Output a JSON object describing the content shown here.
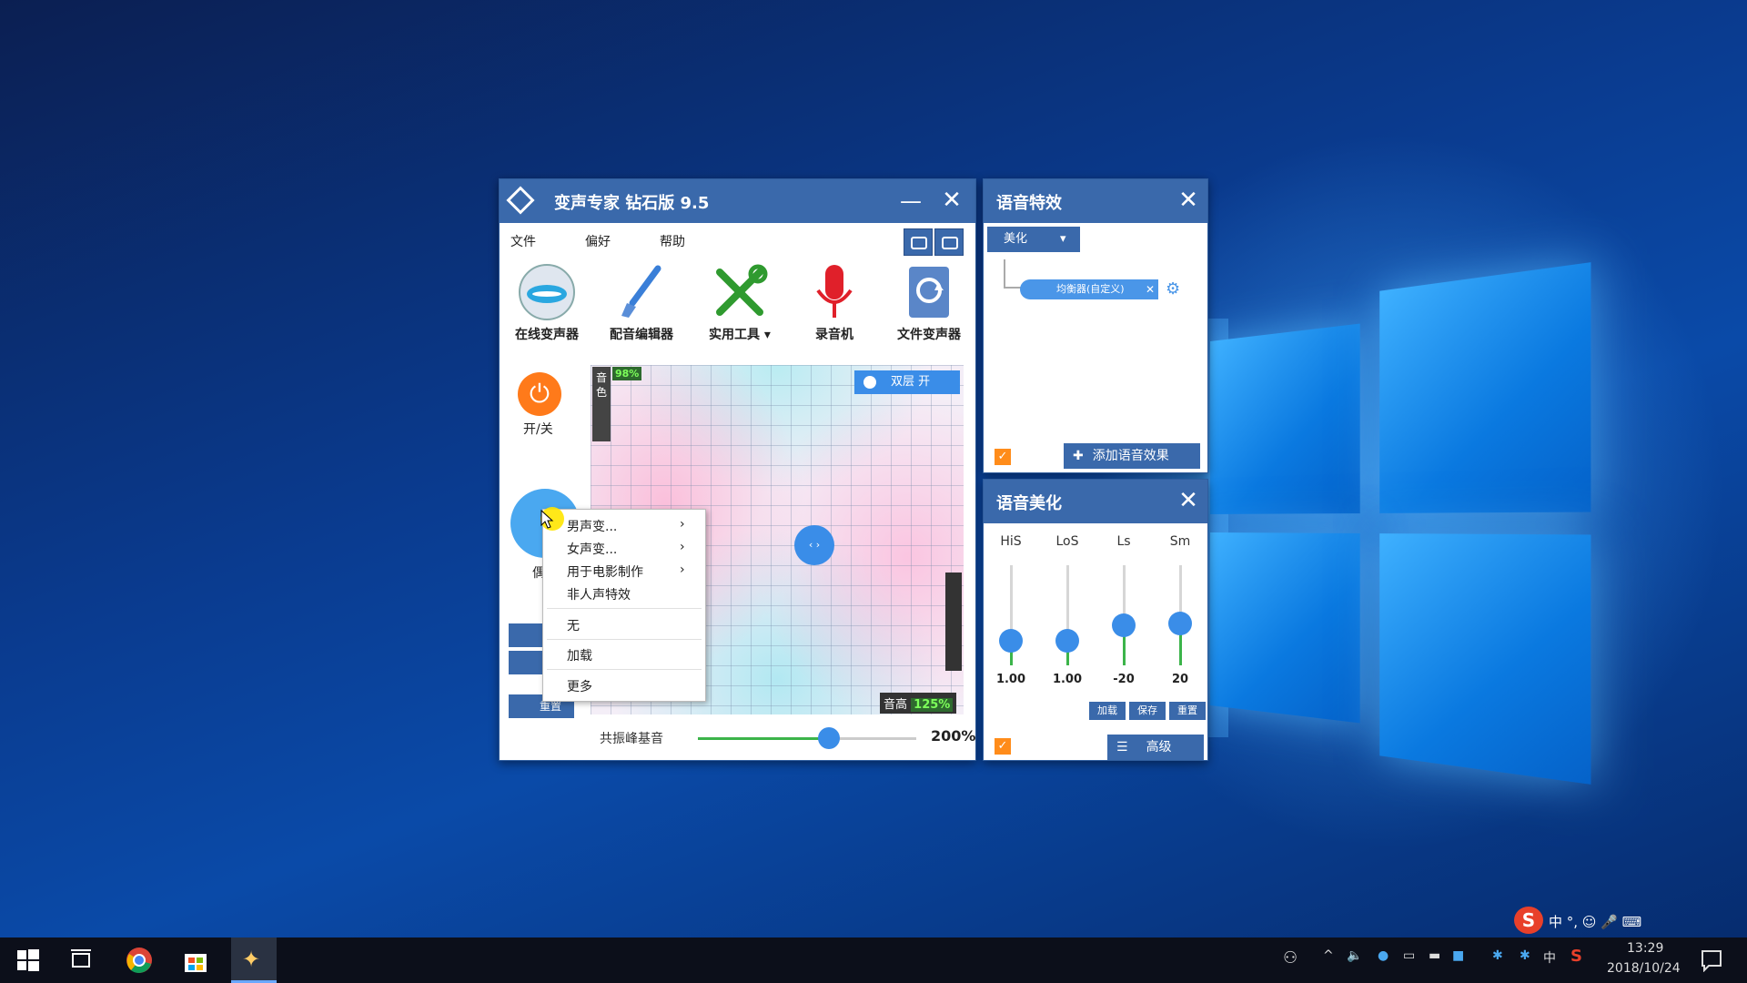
{
  "app": {
    "title": "变声专家  钻石版  9.5",
    "menu": [
      "文件",
      "偏好",
      "帮助"
    ],
    "tools": [
      {
        "label": "在线变声器",
        "icon": "lips-globe-icon"
      },
      {
        "label": "配音编辑器",
        "icon": "brush-icon"
      },
      {
        "label": "实用工具 ▾",
        "icon": "tools-icon"
      },
      {
        "label": "录音机",
        "icon": "microphone-icon"
      },
      {
        "label": "文件变声器",
        "icon": "file-refresh-icon"
      }
    ],
    "power_label": "开/关",
    "side_label_partial": "偶",
    "reset_label": "重置",
    "pad": {
      "timbre_label": "音色",
      "timbre_value": "98%",
      "dual_label": "双层  开",
      "pitch_label": "音高",
      "pitch_value": "125%"
    },
    "resonance": {
      "label": "共振峰基音",
      "value": "200%",
      "fraction": 0.6
    }
  },
  "context_menu": {
    "items": [
      "男声变...",
      "女声变...",
      "用于电影制作",
      "非人声特效"
    ],
    "items2": [
      "无",
      "加载",
      "更多"
    ]
  },
  "effects_panel": {
    "title": "语音特效",
    "dropdown": "美化",
    "chip": "均衡器(自定义)",
    "add_button": "添加语音效果"
  },
  "beauty_panel": {
    "title": "语音美化",
    "sliders": [
      {
        "label": "HiS",
        "value": "1.00",
        "level": 0.25
      },
      {
        "label": "LoS",
        "value": "1.00",
        "level": 0.25
      },
      {
        "label": "Ls",
        "value": "-20",
        "level": 0.4
      },
      {
        "label": "Sm",
        "value": "20",
        "level": 0.42
      }
    ],
    "buttons": [
      "加载",
      "保存",
      "重置"
    ],
    "advanced": "高级"
  },
  "taskbar": {
    "time": "13:29",
    "date": "2018/10/24",
    "ime": "中",
    "ime_bar": "中 °, ☺ 🎤 ⌨"
  },
  "colors": {
    "accent": "#3a69ab",
    "orange": "#ff7a1a",
    "green": "#3cb44a"
  }
}
